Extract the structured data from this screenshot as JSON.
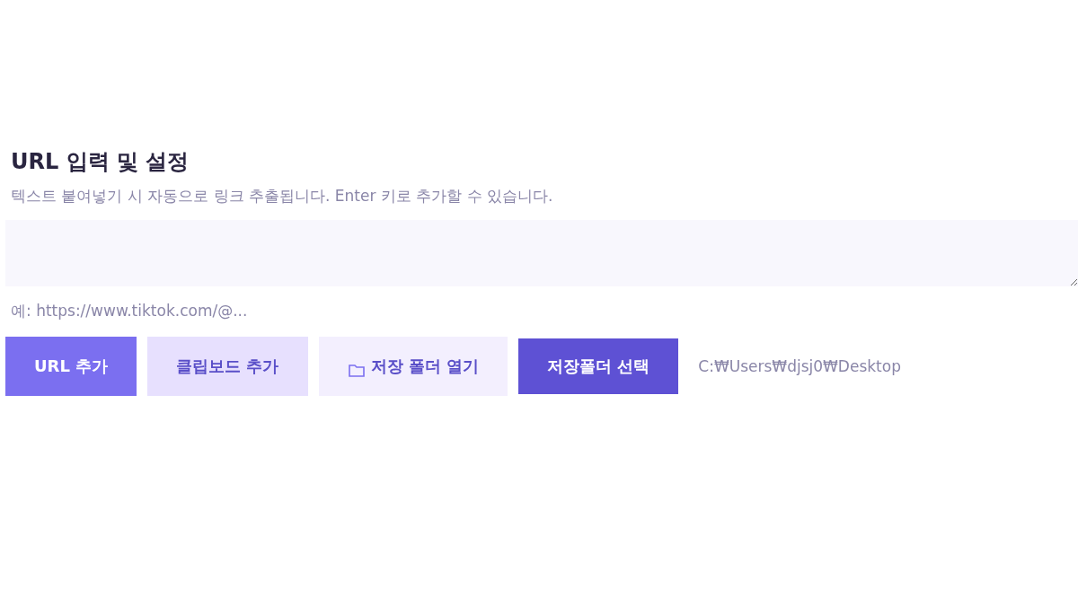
{
  "section": {
    "title": "URL 입력 및 설정",
    "description": "텍스트 붙여넣기 시 자동으로 링크 추출됩니다. Enter 키로 추가할 수 있습니다."
  },
  "url_field": {
    "hint": "예: https://www.tiktok.com/@..."
  },
  "buttons": [
    {
      "label": "URL 추가",
      "kind": "primary"
    },
    {
      "label": "클립보드 추가",
      "kind": "soft"
    },
    {
      "label": "저장 폴더 열기",
      "kind": "folder"
    },
    {
      "label": "저장폴더 선택",
      "kind": "accent"
    }
  ],
  "save_path": "C:₩Users₩djsj0₩Desktop"
}
